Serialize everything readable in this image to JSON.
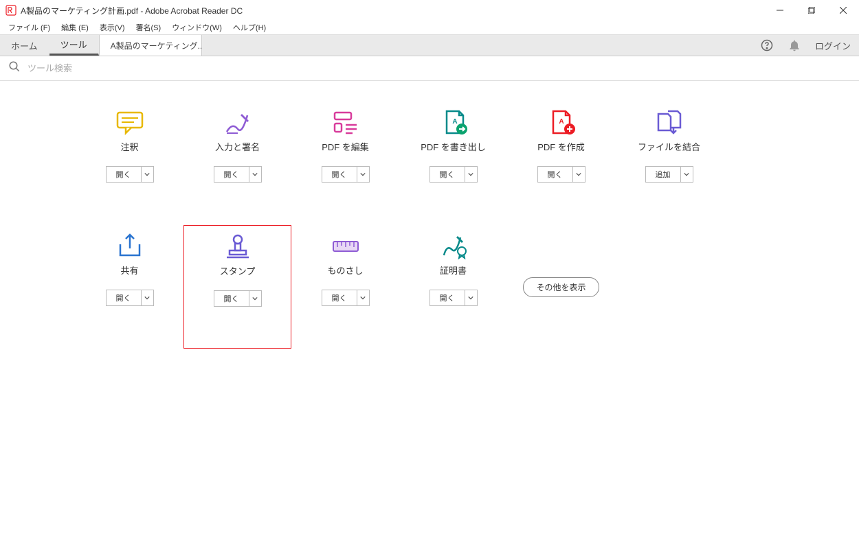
{
  "window": {
    "title": "A製品のマーケティング計画.pdf - Adobe Acrobat Reader DC"
  },
  "menu": {
    "file": "ファイル (F)",
    "edit": "編集 (E)",
    "view": "表示(V)",
    "sign": "署名(S)",
    "window": "ウィンドウ(W)",
    "help": "ヘルプ(H)"
  },
  "tabs": {
    "home": "ホーム",
    "tools": "ツール",
    "document": "A製品のマーケティング..."
  },
  "header": {
    "login": "ログイン"
  },
  "search": {
    "placeholder": "ツール検索"
  },
  "buttons": {
    "open": "開く",
    "add": "追加",
    "show_more": "その他を表示"
  },
  "tools": [
    {
      "id": "comment",
      "label": "注釈",
      "action": "open"
    },
    {
      "id": "fillsign",
      "label": "入力と署名",
      "action": "open"
    },
    {
      "id": "editpdf",
      "label": "PDF を編集",
      "action": "open"
    },
    {
      "id": "export",
      "label": "PDF を書き出し",
      "action": "open"
    },
    {
      "id": "create",
      "label": "PDF を作成",
      "action": "open"
    },
    {
      "id": "combine",
      "label": "ファイルを結合",
      "action": "add"
    },
    {
      "id": "share",
      "label": "共有",
      "action": "open"
    },
    {
      "id": "stamp",
      "label": "スタンプ",
      "action": "open",
      "selected": true
    },
    {
      "id": "measure",
      "label": "ものさし",
      "action": "open"
    },
    {
      "id": "cert",
      "label": "証明書",
      "action": "open"
    }
  ]
}
